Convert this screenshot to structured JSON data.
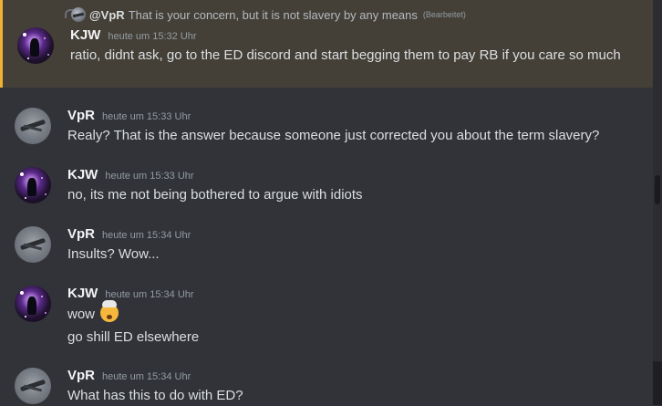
{
  "colors": {
    "background": "#313338",
    "highlight_background": "#444037",
    "highlight_border": "#f0b232",
    "text": "#dbdee1",
    "muted": "#949ba4"
  },
  "reply": {
    "author": "@VpR",
    "text": "That is your concern, but it is not slavery by any means",
    "edited": "(Bearbeitet)"
  },
  "messages": [
    {
      "author": "KJW",
      "timestamp": "heute um 15:32 Uhr",
      "lines": [
        "ratio, didnt ask, go to the ED discord and start begging them to pay RB if you care so much"
      ],
      "avatar_icon": "nebula-avatar"
    },
    {
      "author": "VpR",
      "timestamp": "heute um 15:33 Uhr",
      "lines": [
        "Realy? That is the answer because someone just corrected you about the term slavery?"
      ],
      "avatar_icon": "jet-avatar"
    },
    {
      "author": "KJW",
      "timestamp": "heute um 15:33 Uhr",
      "lines": [
        "no, its me not being bothered to argue with idiots"
      ],
      "avatar_icon": "nebula-avatar"
    },
    {
      "author": "VpR",
      "timestamp": "heute um 15:34 Uhr",
      "lines": [
        "Insults? Wow..."
      ],
      "avatar_icon": "jet-avatar"
    },
    {
      "author": "KJW",
      "timestamp": "heute um 15:34 Uhr",
      "lines": [
        "wow",
        "go shill ED elsewhere"
      ],
      "emoji": "exploding-head-emoji",
      "avatar_icon": "nebula-avatar"
    },
    {
      "author": "VpR",
      "timestamp": "heute um 15:34 Uhr",
      "lines": [
        "What has this to do with ED?"
      ],
      "avatar_icon": "jet-avatar"
    }
  ]
}
